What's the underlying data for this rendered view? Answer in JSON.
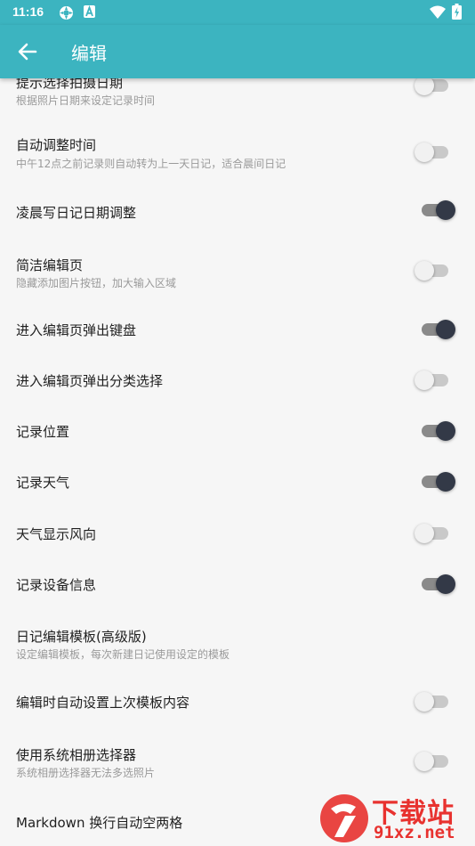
{
  "status_bar": {
    "time": "11:16"
  },
  "app_bar": {
    "title": "编辑"
  },
  "colors": {
    "primary": "#3cb4c0",
    "switch_on_thumb": "#333947",
    "switch_off_thumb": "#f1f1f1",
    "watermark": "#e8322f"
  },
  "settings": [
    {
      "title": "提示选择拍摄日期",
      "subtitle": "根据照片日期来设定记录时间",
      "enabled": false
    },
    {
      "title": "自动调整时间",
      "subtitle": "中午12点之前记录则自动转为上一天日记，适合晨间日记",
      "enabled": false
    },
    {
      "title": "凌晨写日记日期调整",
      "subtitle": "",
      "enabled": true
    },
    {
      "title": "简洁编辑页",
      "subtitle": "隐藏添加图片按钮，加大输入区域",
      "enabled": false
    },
    {
      "title": "进入编辑页弹出键盘",
      "subtitle": "",
      "enabled": true
    },
    {
      "title": "进入编辑页弹出分类选择",
      "subtitle": "",
      "enabled": false
    },
    {
      "title": "记录位置",
      "subtitle": "",
      "enabled": true
    },
    {
      "title": "记录天气",
      "subtitle": "",
      "enabled": true
    },
    {
      "title": "天气显示风向",
      "subtitle": "",
      "enabled": false
    },
    {
      "title": "记录设备信息",
      "subtitle": "",
      "enabled": true
    },
    {
      "title": "日记编辑模板(高级版)",
      "subtitle": "设定编辑模板，每次新建日记使用设定的模板",
      "enabled": null
    },
    {
      "title": "编辑时自动设置上次模板内容",
      "subtitle": "",
      "enabled": false
    },
    {
      "title": "使用系统相册选择器",
      "subtitle": "系统相册选择器无法多选照片",
      "enabled": false
    },
    {
      "title": "Markdown 换行自动空两格",
      "subtitle": "",
      "enabled": null
    }
  ],
  "watermark": {
    "top_text": "下载站",
    "bottom_text": "91xz.net"
  }
}
